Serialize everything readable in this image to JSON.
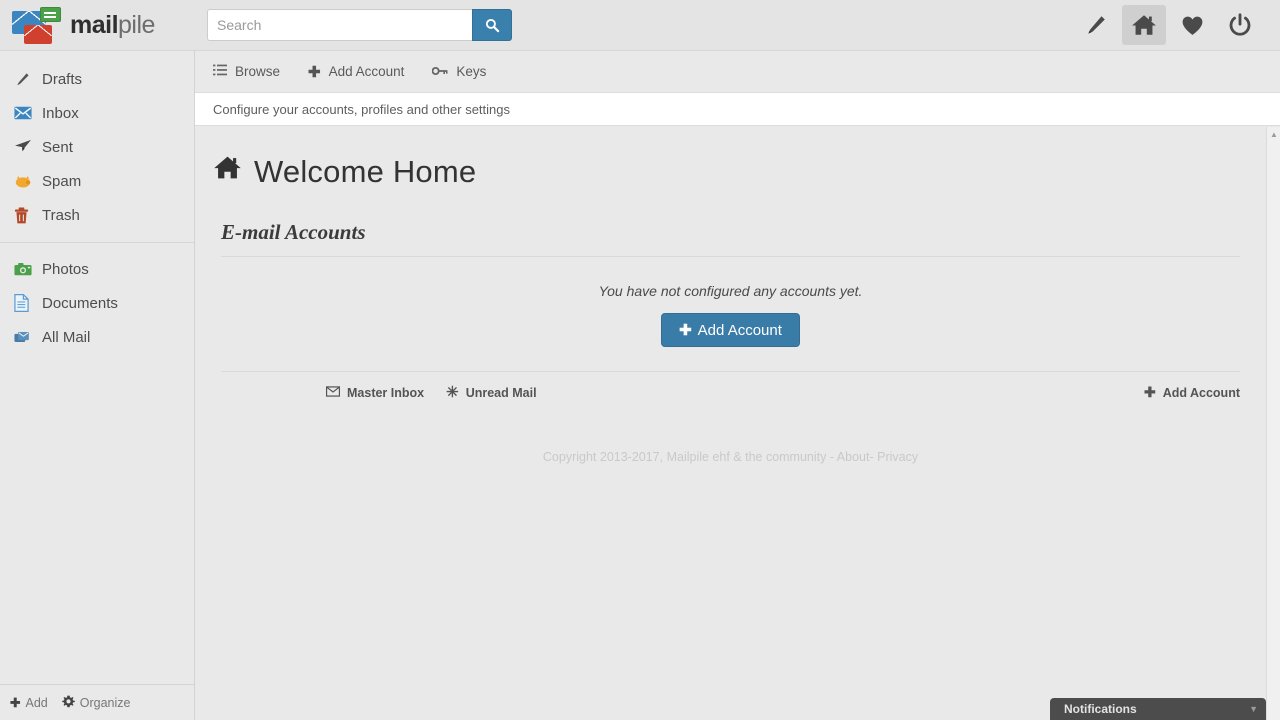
{
  "header": {
    "brand_bold": "mail",
    "brand_light": "pile",
    "logo_icon": "mailpile-envelopes-logo",
    "search": {
      "value": "",
      "placeholder": "Search",
      "button_icon": "search-icon"
    },
    "tools": [
      {
        "name": "compose-icon",
        "title": "Compose"
      },
      {
        "name": "home-icon",
        "title": "Home",
        "active": true
      },
      {
        "name": "heart-icon",
        "title": "Favorites"
      },
      {
        "name": "power-icon",
        "title": "Power"
      }
    ]
  },
  "sidebar": {
    "groups": [
      {
        "items": [
          {
            "label": "Drafts",
            "icon": "pencil-icon"
          },
          {
            "label": "Inbox",
            "icon": "envelope-icon"
          },
          {
            "label": "Sent",
            "icon": "paper-plane-icon"
          },
          {
            "label": "Spam",
            "icon": "pig-icon"
          },
          {
            "label": "Trash",
            "icon": "trash-icon"
          }
        ]
      },
      {
        "items": [
          {
            "label": "Photos",
            "icon": "camera-icon"
          },
          {
            "label": "Documents",
            "icon": "document-icon"
          },
          {
            "label": "All Mail",
            "icon": "all-mail-icon"
          }
        ]
      }
    ],
    "footer": [
      {
        "label": "Add",
        "icon": "plus-icon"
      },
      {
        "label": "Organize",
        "icon": "gear-icon"
      }
    ]
  },
  "subnav": {
    "items": [
      {
        "label": "Browse",
        "icon": "list-icon"
      },
      {
        "label": "Add Account",
        "icon": "plus-icon"
      },
      {
        "label": "Keys",
        "icon": "key-icon"
      }
    ],
    "description": "Configure your accounts, profiles and other settings"
  },
  "main": {
    "title": "Welcome Home",
    "title_icon": "home-icon",
    "section_title": "E-mail Accounts",
    "empty_message": "You have not configured any accounts yet.",
    "add_account_button": "Add Account",
    "actions": [
      {
        "label": "Master Inbox",
        "icon": "envelope-icon"
      },
      {
        "label": "Unread Mail",
        "icon": "asterisk-icon"
      }
    ],
    "action_right": {
      "label": "Add Account",
      "icon": "plus-icon"
    },
    "copyright": {
      "text": "Copyright 2013-2017, Mailpile ehf & the community - ",
      "about": "About",
      "separator": "- ",
      "privacy": "Privacy"
    }
  },
  "notifications": {
    "label": "Notifications",
    "caret_icon": "chevron-down-icon"
  },
  "colors": {
    "accent_blue": "#3a7ca8",
    "header_bg": "#e4e4e4",
    "body_bg": "#e9e9e9",
    "notification_bg": "#4c4c4c"
  }
}
